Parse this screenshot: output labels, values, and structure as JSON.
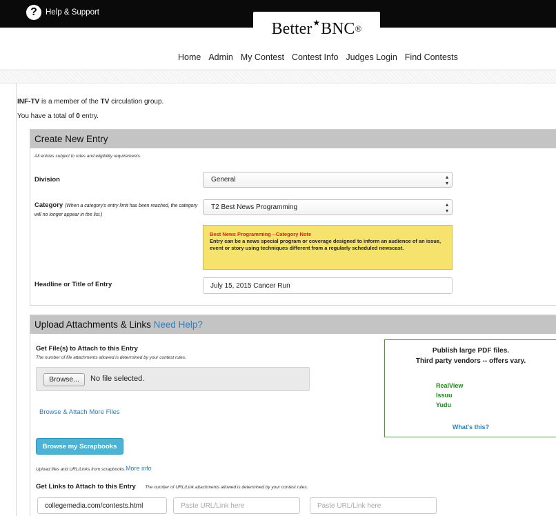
{
  "header": {
    "help_label": "Help & Support",
    "logo_text_1": "Better",
    "logo_text_2": "BNC",
    "logo_reg": "®",
    "nav": [
      "Home",
      "Admin",
      "My Contest",
      "Contest Info",
      "Judges Login",
      "Find Contests"
    ]
  },
  "intro": {
    "member_name": "INF-TV",
    "member_text": " is a member of the ",
    "group_name": "TV",
    "group_text": " circulation group.",
    "total_prefix": "You have a total of ",
    "total_count": "0",
    "total_suffix": " entry."
  },
  "create": {
    "heading": "Create New Entry",
    "note": "All entries subject to rules and eligibility requirements.",
    "division_label": "Division",
    "division_value": "General",
    "category_label": "Category",
    "category_hint": "(When a category's entry limit has been reached, the category will no longer appear in the list.)",
    "category_value": "T2 Best News Programming",
    "category_note_title": "Best News Programming --Category Note",
    "category_note_body": "Entry can be a news special program or coverage designed to inform an audience of an issue, event or story using techniques different from a regularly scheduled newscast.",
    "headline_label": "Headline or Title of Entry",
    "headline_value": "July 15, 2015 Cancer Run"
  },
  "upload": {
    "heading": "Upload Attachments & Links",
    "help_link": "Need Help?",
    "files_label": "Get File(s) to Attach to this Entry",
    "files_note": "The number of file attachments allowed is determined by your contest rules.",
    "browse_label": "Browse...",
    "no_file": "No file selected.",
    "more_files": "Browse & Attach More Files",
    "scrap_button": "Browse my Scrapbooks",
    "scrap_note": "Upload files and URL/Links from scrapbooks.",
    "more_info": "More info",
    "links_label": "Get Links to Attach to this Entry",
    "links_note": "The number of URL/Link attachments allowed is determined by your contest rules.",
    "link1_value": "collegemedia.com/contests.html",
    "link_placeholder": "Paste URL/Link here"
  },
  "pdf_box": {
    "line1": "Publish large PDF files.",
    "line2": "Third party vendors  -- offers vary.",
    "vendors": [
      "RealView",
      "Issuu",
      "Yudu"
    ],
    "whats_this": "What's this?"
  },
  "colors": {
    "top_bar": "#0a0a0a",
    "panel_header": "#c4c4c4",
    "link_blue": "#2c7fc4",
    "note_yellow": "#f5e36e",
    "vendor_green": "#1a8a1a",
    "scrap_button": "#4cb2d6"
  }
}
